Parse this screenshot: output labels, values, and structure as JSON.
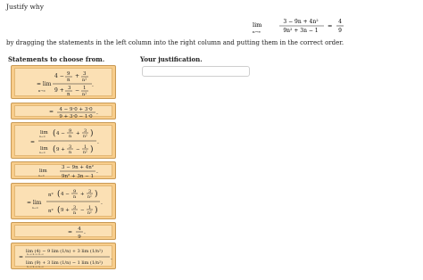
{
  "prompt": {
    "intro": "Justify why",
    "instruction": "by dragging the statements in the left column into the right column and putting them in the correct order."
  },
  "goal": {
    "lim": "lim",
    "lim_sub": "n→∞",
    "num": "3 − 9n + 4n²",
    "den": "9n² + 3n − 1",
    "eq": "=",
    "rnum": "4",
    "rden": "9"
  },
  "columns": {
    "left_header": "Statements to choose from.",
    "right_header": "Your justification."
  },
  "statements": [
    {
      "id": "s1",
      "text": "= lim (4 − 9/n + 3/n²) / (9 + 3/n − 1/n²)"
    },
    {
      "id": "s2",
      "text": "= (4 − 9·0 + 3·0) / (9 + 3·0 − 1·0)"
    },
    {
      "id": "s3",
      "text": "= lim(4 − 9/n + 3/n²) / lim(9 + 3/n − 1/n²)"
    },
    {
      "id": "s4",
      "text": "lim (3 − 9n + 4n²)/(9n² + 3n − 1)"
    },
    {
      "id": "s5",
      "text": "= lim n²(4 − 9/n + 3/n²) / n²(9 + 3/n − 1/n²)"
    },
    {
      "id": "s6",
      "text": "= 4/9"
    },
    {
      "id": "s7",
      "text": "= (lim(4) − 9 lim(1/n) + 3 lim(1/n²)) / (lim(9) + 3 lim(1/n) − 1 lim(1/n²))"
    }
  ]
}
